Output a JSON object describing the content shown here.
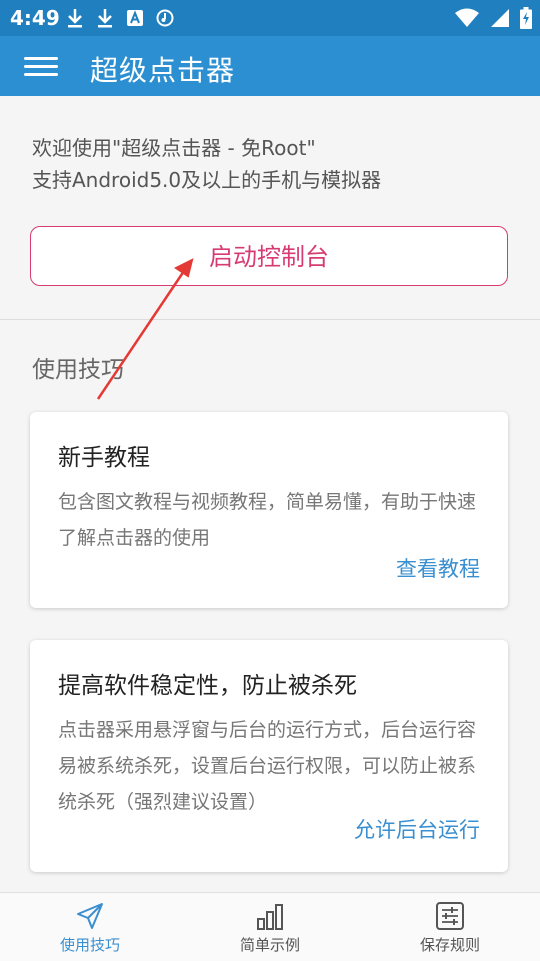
{
  "status": {
    "time": "4:49"
  },
  "appbar": {
    "title": "超级点击器"
  },
  "intro": {
    "line1": "欢迎使用\"超级点击器 - 免Root\"",
    "line2": "支持Android5.0及以上的手机与模拟器"
  },
  "launch_button": "启动控制台",
  "section_title": "使用技巧",
  "cards": [
    {
      "title": "新手教程",
      "desc": "包含图文教程与视频教程，简单易懂，有助于快速了解点击器的使用",
      "link": "查看教程"
    },
    {
      "title": "提高软件稳定性，防止被杀死",
      "desc": "点击器采用悬浮窗与后台的运行方式，后台运行容易被系统杀死，设置后台运行权限，可以防止被系统杀死（强烈建议设置）",
      "link": "允许后台运行"
    }
  ],
  "bottom_nav": [
    {
      "label": "使用技巧",
      "icon": "send-icon"
    },
    {
      "label": "简单示例",
      "icon": "bar-chart-icon"
    },
    {
      "label": "保存规则",
      "icon": "sliders-icon"
    }
  ],
  "colors": {
    "statusbar": "#1f7fbf",
    "appbar": "#2b8fd1",
    "accent": "#d63b72",
    "link": "#3a8fd0"
  }
}
